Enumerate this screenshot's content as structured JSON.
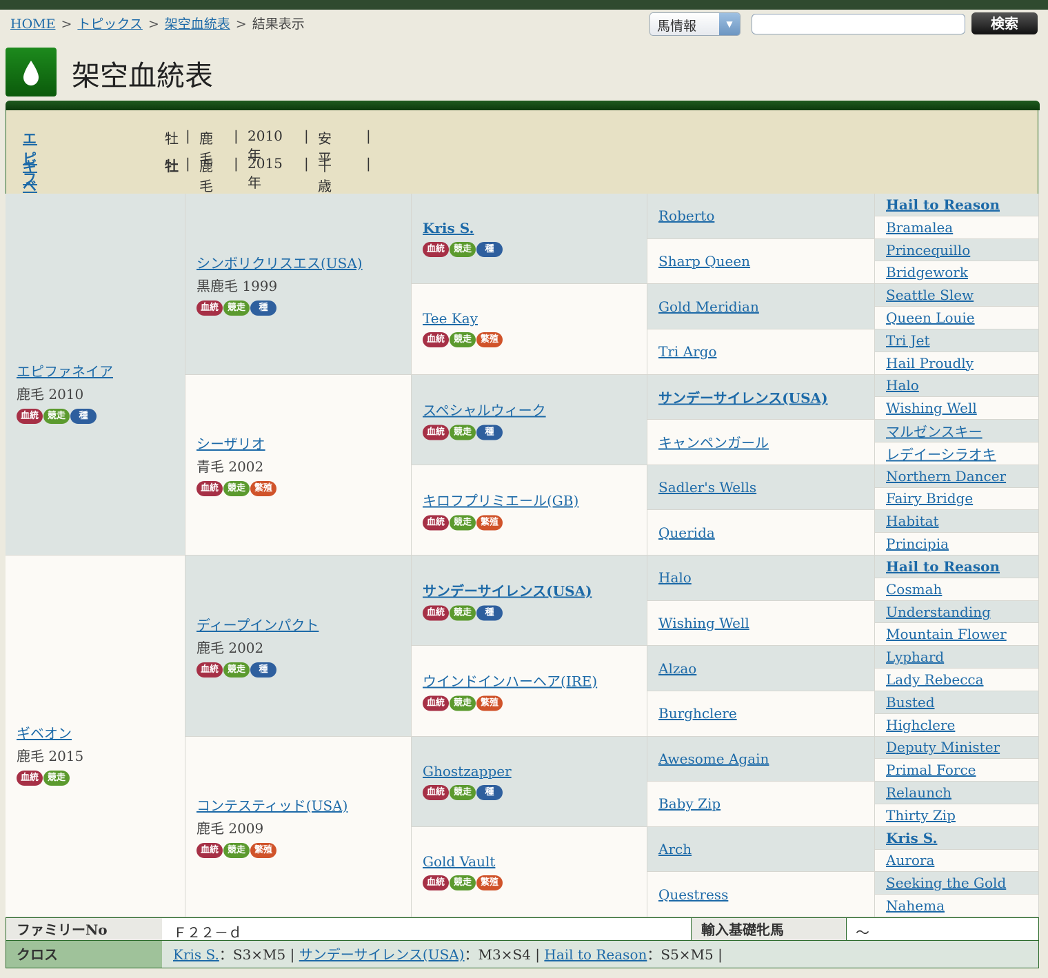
{
  "breadcrumb": {
    "home": "HOME",
    "sep": ">",
    "topics": "トピックス",
    "page": "架空血統表",
    "current": "結果表示"
  },
  "search": {
    "select": "馬情報",
    "button": "検索",
    "input": ""
  },
  "title": "架空血統表",
  "info": {
    "rows": [
      {
        "name": "エピファネイア",
        "sex": "牡",
        "color": "鹿毛",
        "year": "2010年",
        "area": "安　平"
      },
      {
        "name": "ギベオン",
        "sex": "牡",
        "color": "鹿毛",
        "year": "2015年",
        "area": "千　歳"
      }
    ],
    "divider": "|"
  },
  "badges": {
    "blood": "血統",
    "race": "競走",
    "stud": "種",
    "breed": "繁殖"
  },
  "pedigree": {
    "g1": [
      {
        "name": "エピファネイア",
        "info": "鹿毛 2010",
        "badges": [
          "r",
          "g",
          "b"
        ]
      },
      {
        "name": "ギベオン",
        "info": "鹿毛 2015",
        "badges": [
          "r",
          "g"
        ]
      }
    ],
    "g2": [
      {
        "name": "シンボリクリスエス(USA)",
        "info": "黒鹿毛 1999",
        "badges": [
          "r",
          "g",
          "b"
        ]
      },
      {
        "name": "シーザリオ",
        "info": "青毛 2002",
        "badges": [
          "r",
          "g",
          "o"
        ]
      },
      {
        "name": "ディープインパクト",
        "info": "鹿毛 2002",
        "badges": [
          "r",
          "g",
          "b"
        ]
      },
      {
        "name": "コンテスティッド(USA)",
        "info": "鹿毛 2009",
        "badges": [
          "r",
          "g",
          "o"
        ]
      }
    ],
    "g3": [
      {
        "name": "Kris S.",
        "bold": true,
        "badges": [
          "r",
          "g",
          "b"
        ]
      },
      {
        "name": "Tee Kay",
        "badges": [
          "r",
          "g",
          "o"
        ]
      },
      {
        "name": "スペシャルウィーク",
        "badges": [
          "r",
          "g",
          "b"
        ]
      },
      {
        "name": "キロフプリミエール(GB)",
        "badges": [
          "r",
          "g",
          "o"
        ]
      },
      {
        "name": "サンデーサイレンス(USA)",
        "bold": true,
        "badges": [
          "r",
          "g",
          "b"
        ]
      },
      {
        "name": "ウインドインハーヘア(IRE)",
        "badges": [
          "r",
          "g",
          "o"
        ]
      },
      {
        "name": "Ghostzapper",
        "badges": [
          "r",
          "g",
          "b"
        ]
      },
      {
        "name": "Gold Vault",
        "badges": [
          "r",
          "g",
          "o"
        ]
      }
    ],
    "g4": [
      {
        "name": "Roberto"
      },
      {
        "name": "Sharp Queen"
      },
      {
        "name": "Gold Meridian"
      },
      {
        "name": "Tri Argo"
      },
      {
        "name": "サンデーサイレンス(USA)",
        "bold": true
      },
      {
        "name": "キャンペンガール"
      },
      {
        "name": "Sadler's Wells"
      },
      {
        "name": "Querida"
      },
      {
        "name": "Halo"
      },
      {
        "name": "Wishing Well"
      },
      {
        "name": "Alzao"
      },
      {
        "name": "Burghclere"
      },
      {
        "name": "Awesome Again"
      },
      {
        "name": "Baby Zip"
      },
      {
        "name": "Arch"
      },
      {
        "name": "Questress"
      }
    ],
    "g5": [
      {
        "name": "Hail to Reason",
        "bold": true
      },
      {
        "name": "Bramalea"
      },
      {
        "name": "Princequillo"
      },
      {
        "name": "Bridgework"
      },
      {
        "name": "Seattle Slew"
      },
      {
        "name": "Queen Louie"
      },
      {
        "name": "Tri Jet"
      },
      {
        "name": "Hail Proudly"
      },
      {
        "name": "Halo"
      },
      {
        "name": "Wishing Well"
      },
      {
        "name": "マルゼンスキー"
      },
      {
        "name": "レデイーシラオキ"
      },
      {
        "name": "Northern Dancer"
      },
      {
        "name": "Fairy Bridge"
      },
      {
        "name": "Habitat"
      },
      {
        "name": "Principia"
      },
      {
        "name": "Hail to Reason",
        "bold": true
      },
      {
        "name": "Cosmah"
      },
      {
        "name": "Understanding"
      },
      {
        "name": "Mountain Flower"
      },
      {
        "name": "Lyphard"
      },
      {
        "name": "Lady Rebecca"
      },
      {
        "name": "Busted"
      },
      {
        "name": "Highclere"
      },
      {
        "name": "Deputy Minister"
      },
      {
        "name": "Primal Force"
      },
      {
        "name": "Relaunch"
      },
      {
        "name": "Thirty Zip"
      },
      {
        "name": "Kris S.",
        "bold": true
      },
      {
        "name": "Aurora"
      },
      {
        "name": "Seeking the Gold"
      },
      {
        "name": "Nahema"
      }
    ]
  },
  "family": {
    "label": "ファミリーNo",
    "value": "Ｆ２２－ｄ",
    "import_label": "輸入基礎牝馬",
    "import_value": "～"
  },
  "cross": {
    "label": "クロス",
    "items": [
      {
        "name": "Kris S.",
        "val": "：S3×M5"
      },
      {
        "name": "サンデーサイレンス(USA)",
        "val": "：M3×S4"
      },
      {
        "name": "Hail to Reason",
        "val": "：S5×M5"
      }
    ],
    "divider": "|"
  },
  "colors": {
    "green": "#0d5a0d",
    "link": "#1d6aa8",
    "shade": "#dde4e2",
    "light": "#fcfaf6",
    "info_bg": "#e7e1c5",
    "cross_bg": "#dce6de",
    "cross_label_bg": "#9fc29a"
  }
}
